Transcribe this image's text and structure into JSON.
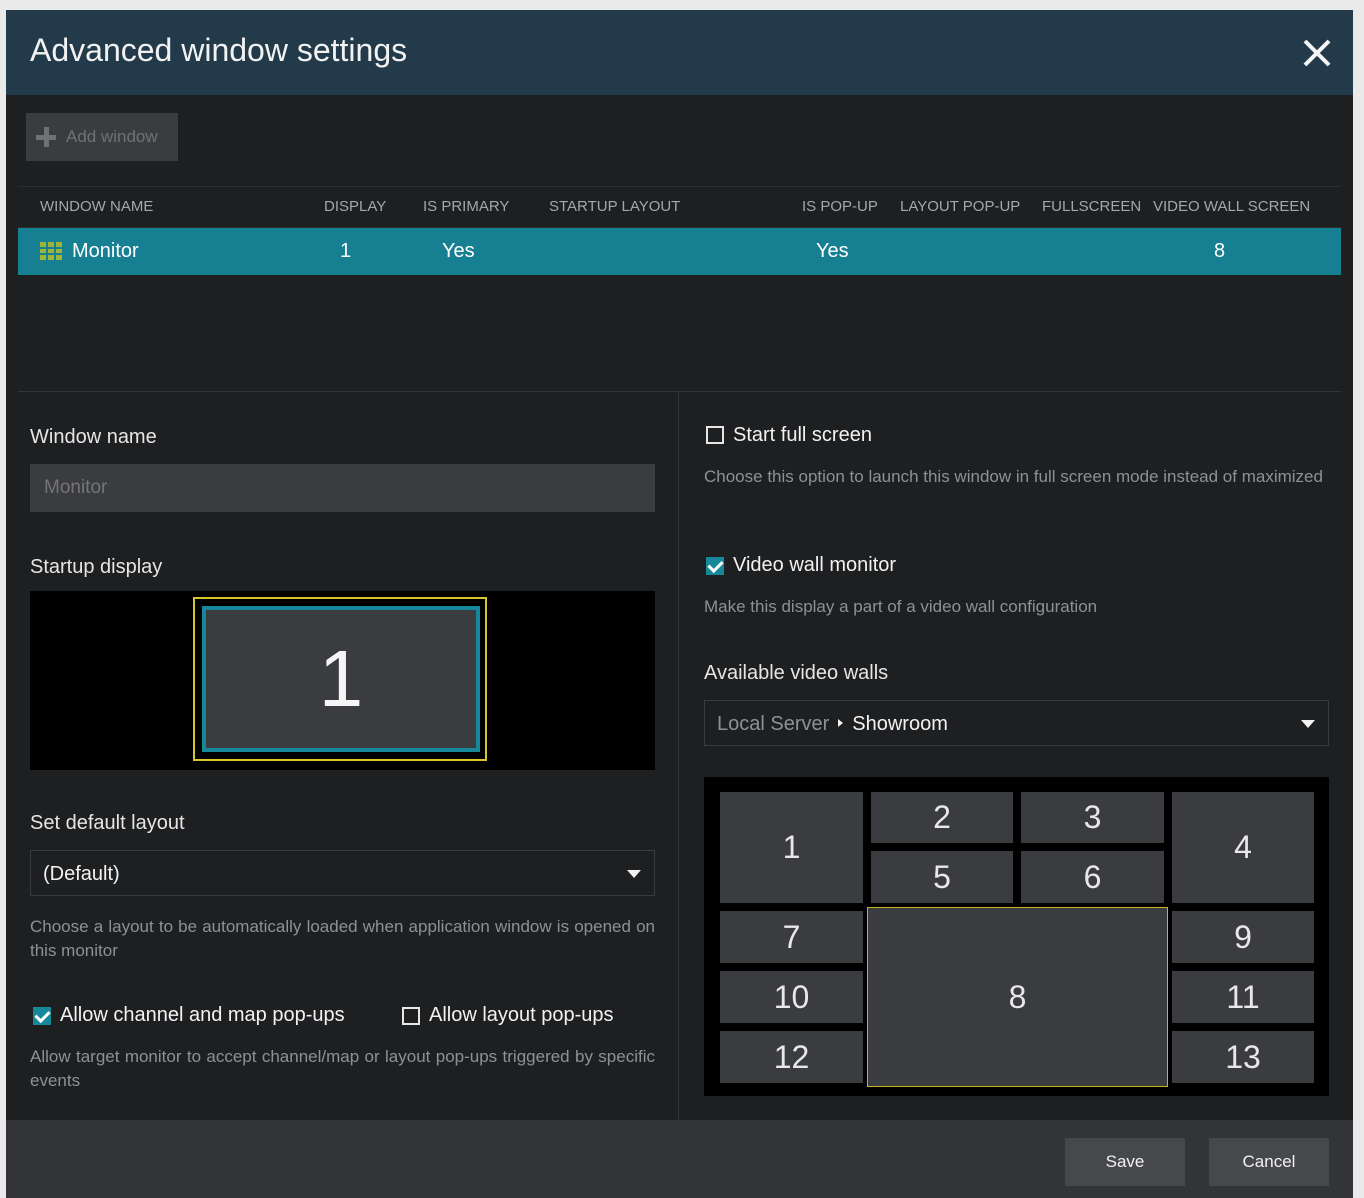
{
  "dialog": {
    "title": "Advanced window settings"
  },
  "toolbar": {
    "add_window_label": "Add window"
  },
  "table": {
    "columns": [
      "WINDOW NAME",
      "DISPLAY",
      "IS PRIMARY",
      "STARTUP LAYOUT",
      "IS POP-UP",
      "LAYOUT POP-UP",
      "FULLSCREEN",
      "VIDEO WALL SCREEN"
    ],
    "rows": [
      {
        "window_name": "Monitor",
        "display": "1",
        "is_primary": "Yes",
        "startup_layout": "",
        "is_popup": "Yes",
        "layout_popup": "",
        "fullscreen": "",
        "video_wall_screen": "8"
      }
    ]
  },
  "left": {
    "window_name_label": "Window name",
    "window_name_placeholder": "Monitor",
    "startup_display_label": "Startup display",
    "displays": [
      "1"
    ],
    "default_layout_label": "Set default layout",
    "default_layout_value": "(Default)",
    "default_layout_hint": "Choose a layout to be automatically loaded when application window is opened on this monitor",
    "allow_channel_popups_label": "Allow channel and map pop-ups",
    "allow_channel_popups_checked": true,
    "allow_layout_popups_label": "Allow layout pop-ups",
    "allow_layout_popups_checked": false,
    "popups_hint": "Allow target monitor to accept channel/map or layout pop-ups triggered by specific events"
  },
  "right": {
    "start_fullscreen_label": "Start full screen",
    "start_fullscreen_checked": false,
    "start_fullscreen_hint": "Choose this option to launch this window in full screen mode instead of maximized",
    "video_wall_monitor_label": "Video wall monitor",
    "video_wall_monitor_checked": true,
    "video_wall_monitor_hint": "Make this display a part of a video wall configuration",
    "available_walls_label": "Available video walls",
    "wall_server": "Local Server",
    "wall_name": "Showroom",
    "wall_screens": [
      "1",
      "2",
      "3",
      "4",
      "5",
      "6",
      "7",
      "8",
      "9",
      "10",
      "11",
      "12",
      "13"
    ],
    "selected_screen": "8"
  },
  "footer": {
    "save_label": "Save",
    "cancel_label": "Cancel"
  },
  "colors": {
    "title_bar": "#223a4a",
    "selected_row": "#167f91",
    "accent": "#17889a",
    "selection_outline": "#d8c52a",
    "background": "#1e1f21"
  }
}
